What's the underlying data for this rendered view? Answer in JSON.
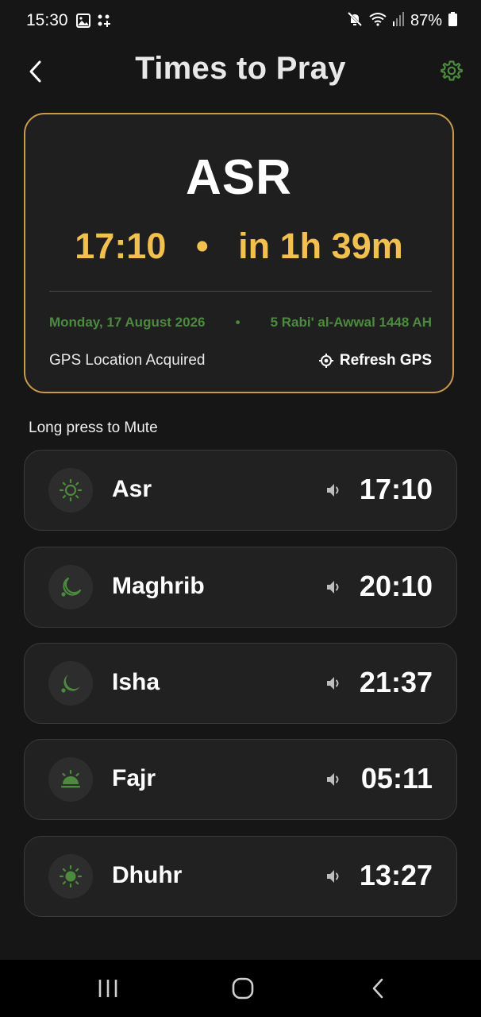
{
  "status_bar": {
    "time": "15:30",
    "battery": "87%"
  },
  "header": {
    "title": "Times to Pray",
    "back_icon": "chevron-left-icon",
    "settings_icon": "gear-icon"
  },
  "next_prayer": {
    "name": "ASR",
    "time": "17:10",
    "separator": "•",
    "countdown": "in 1h 39m",
    "gregorian_date": "Monday, 17 August 2026",
    "date_separator": "•",
    "hijri_date": "5 Rabi' al-Awwal 1448 AH",
    "gps_status": "GPS Location Acquired",
    "refresh_label": "Refresh GPS"
  },
  "hint": "Long press to Mute",
  "prayers": [
    {
      "name": "Asr",
      "time": "17:10",
      "icon": "sun-outline-icon",
      "sound_icon": "speaker-icon"
    },
    {
      "name": "Maghrib",
      "time": "20:10",
      "icon": "crescent-moon-icon",
      "sound_icon": "speaker-icon"
    },
    {
      "name": "Isha",
      "time": "21:37",
      "icon": "moon-icon",
      "sound_icon": "speaker-icon"
    },
    {
      "name": "Fajr",
      "time": "05:11",
      "icon": "sunrise-icon",
      "sound_icon": "speaker-icon"
    },
    {
      "name": "Dhuhr",
      "time": "13:27",
      "icon": "sun-icon",
      "sound_icon": "speaker-icon"
    }
  ],
  "colors": {
    "accent_gold": "#f2c04e",
    "card_border": "#c99a4e",
    "green": "#4c8a3e",
    "background": "#161616"
  }
}
